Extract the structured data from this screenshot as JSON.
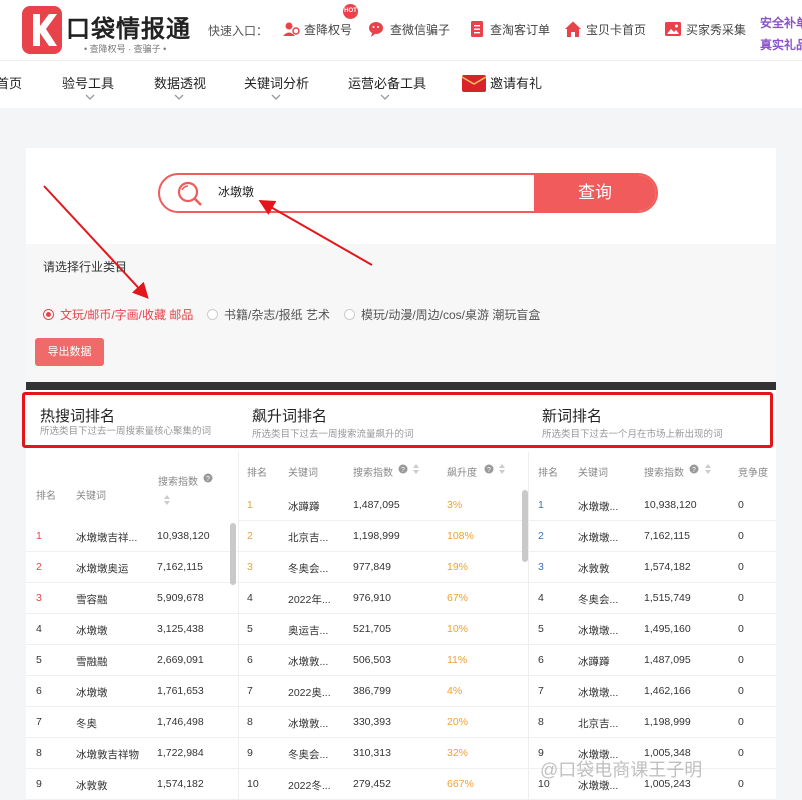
{
  "header": {
    "logo_title": "口袋情报通",
    "logo_subtitle": "• 查降权号 · 查骗子 •",
    "quick_label": "快速入口：",
    "quick_links": [
      {
        "label": "查降权号",
        "icon": "user-check-icon"
      },
      {
        "label": "查微信骗子",
        "icon": "wechat-scam-icon"
      },
      {
        "label": "查淘客订单",
        "icon": "order-list-icon"
      },
      {
        "label": "宝贝卡首页",
        "icon": "home-icon"
      },
      {
        "label": "买家秀采集",
        "icon": "image-icon"
      }
    ],
    "hot_badge": "HOT",
    "safe_line1": "安全补单",
    "safe_line2": "真实礼品"
  },
  "nav": {
    "items": [
      "首页",
      "验号工具",
      "数据透视",
      "关键词分析",
      "运营必备工具",
      "邀请有礼"
    ]
  },
  "search": {
    "value": "冰墩墩",
    "button": "查询"
  },
  "industry": {
    "label": "请选择行业类目",
    "options": [
      "文玩/邮币/字画/收藏 邮品",
      "书籍/杂志/报纸 艺术",
      "模玩/动漫/周边/cos/桌游 潮玩盲盒"
    ],
    "selected": 0
  },
  "export_button": "导出数据",
  "sections": {
    "hot": {
      "title": "热搜词排名",
      "subtitle": "所选类目下过去一周搜索量核心聚集的词"
    },
    "rising": {
      "title": "飙升词排名",
      "subtitle": "所选类目下过去一周搜索流量飙升的词"
    },
    "new": {
      "title": "新词排名",
      "subtitle": "所选类目下过去一个月在市场上新出现的词"
    }
  },
  "hot_table": {
    "headers": {
      "rank": "排名",
      "keyword": "关键词",
      "index": "搜索指数"
    },
    "rows": [
      {
        "rank": "1",
        "keyword": "冰墩墩吉祥...",
        "index": "10,938,120"
      },
      {
        "rank": "2",
        "keyword": "冰墩墩奥运",
        "index": "7,162,115"
      },
      {
        "rank": "3",
        "keyword": "雪容融",
        "index": "5,909,678"
      },
      {
        "rank": "4",
        "keyword": "冰墩墩",
        "index": "3,125,438"
      },
      {
        "rank": "5",
        "keyword": "雪融融",
        "index": "2,669,091"
      },
      {
        "rank": "6",
        "keyword": "冰墩墩",
        "index": "1,761,653"
      },
      {
        "rank": "7",
        "keyword": "冬奥",
        "index": "1,746,498"
      },
      {
        "rank": "8",
        "keyword": "冰墩敦吉祥物",
        "index": "1,722,984"
      },
      {
        "rank": "9",
        "keyword": "冰敦敦",
        "index": "1,574,182"
      }
    ]
  },
  "rising_table": {
    "headers": {
      "rank": "排名",
      "keyword": "关键词",
      "index": "搜索指数",
      "rise": "飙升度"
    },
    "rows": [
      {
        "rank": "1",
        "keyword": "冰蹲蹲",
        "index": "1,487,095",
        "rise": "3%"
      },
      {
        "rank": "2",
        "keyword": "北京吉...",
        "index": "1,198,999",
        "rise": "108%"
      },
      {
        "rank": "3",
        "keyword": "冬奥会...",
        "index": "977,849",
        "rise": "19%"
      },
      {
        "rank": "4",
        "keyword": "2022年...",
        "index": "976,910",
        "rise": "67%"
      },
      {
        "rank": "5",
        "keyword": "奥运吉...",
        "index": "521,705",
        "rise": "10%"
      },
      {
        "rank": "6",
        "keyword": "冰墩敦...",
        "index": "506,503",
        "rise": "11%"
      },
      {
        "rank": "7",
        "keyword": "2022奥...",
        "index": "386,799",
        "rise": "4%"
      },
      {
        "rank": "8",
        "keyword": "冰墩敦...",
        "index": "330,393",
        "rise": "20%"
      },
      {
        "rank": "9",
        "keyword": "冬奥会...",
        "index": "310,313",
        "rise": "32%"
      },
      {
        "rank": "10",
        "keyword": "2022冬...",
        "index": "279,452",
        "rise": "667%"
      }
    ]
  },
  "new_table": {
    "headers": {
      "rank": "排名",
      "keyword": "关键词",
      "index": "搜索指数",
      "competition": "竞争度"
    },
    "rows": [
      {
        "rank": "1",
        "keyword": "冰墩墩...",
        "index": "10,938,120",
        "competition": "0"
      },
      {
        "rank": "2",
        "keyword": "冰墩墩...",
        "index": "7,162,115",
        "competition": "0"
      },
      {
        "rank": "3",
        "keyword": "冰敦敦",
        "index": "1,574,182",
        "competition": "0"
      },
      {
        "rank": "4",
        "keyword": "冬奥会...",
        "index": "1,515,749",
        "competition": "0"
      },
      {
        "rank": "5",
        "keyword": "冰墩墩...",
        "index": "1,495,160",
        "competition": "0"
      },
      {
        "rank": "6",
        "keyword": "冰蹲蹲",
        "index": "1,487,095",
        "competition": "0"
      },
      {
        "rank": "7",
        "keyword": "冰墩墩...",
        "index": "1,462,166",
        "competition": "0"
      },
      {
        "rank": "8",
        "keyword": "北京吉...",
        "index": "1,198,999",
        "competition": "0"
      },
      {
        "rank": "9",
        "keyword": "冰墩墩...",
        "index": "1,005,348",
        "competition": "0"
      },
      {
        "rank": "10",
        "keyword": "冰墩墩...",
        "index": "1,005,243",
        "competition": "0"
      }
    ]
  },
  "watermark": "@口袋电商课王子明",
  "colors": {
    "accent": "#f15b5b",
    "annotation": "#e4161c",
    "nav_purple": "#8a55c8"
  }
}
